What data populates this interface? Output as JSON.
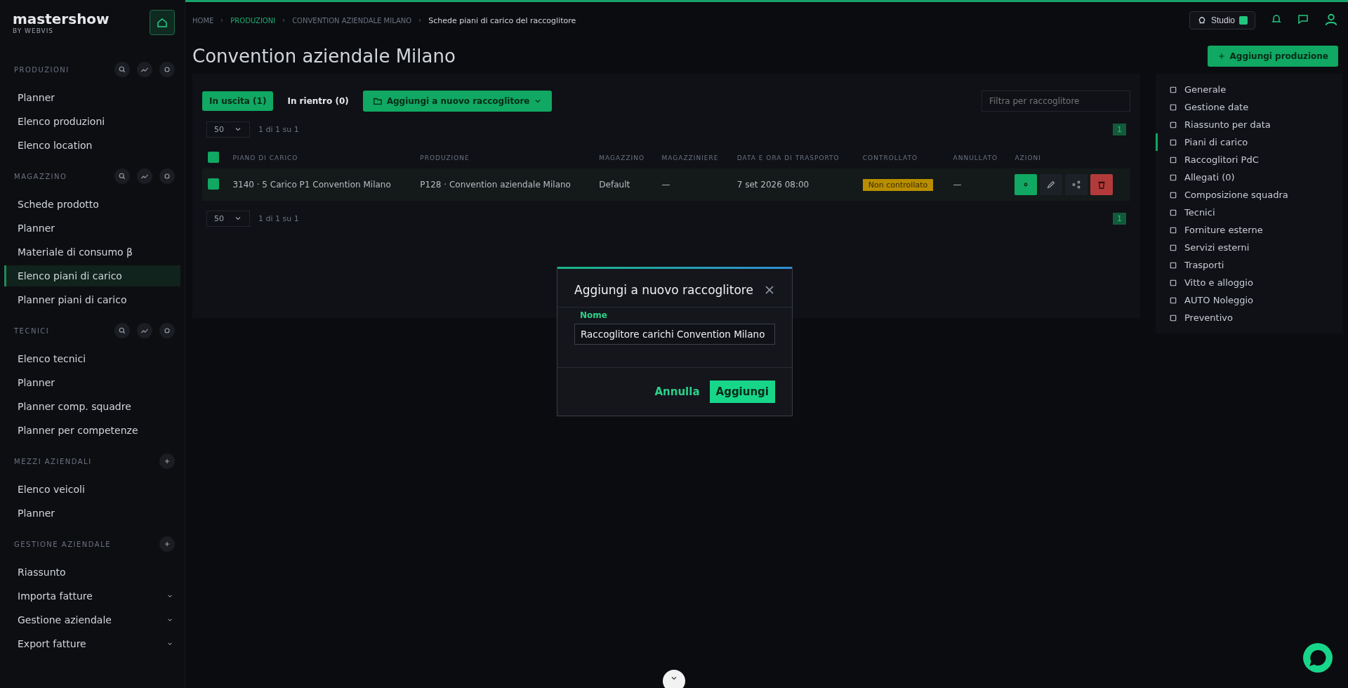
{
  "sidebar": {
    "brand": "mastershow",
    "brand_sub": "BY WEBVIS",
    "sections": [
      {
        "title": "PRODUZIONI",
        "items": [
          {
            "label": "Planner",
            "selected": false
          },
          {
            "label": "Elenco produzioni",
            "selected": false
          },
          {
            "label": "Elenco location",
            "selected": false
          }
        ]
      },
      {
        "title": "MAGAZZINO",
        "items": [
          {
            "label": "Schede prodotto",
            "selected": false
          },
          {
            "label": "Planner",
            "selected": false
          },
          {
            "label": "Materiale di consumo β",
            "selected": false
          },
          {
            "label": "Elenco piani di carico",
            "selected": true
          },
          {
            "label": "Planner piani di carico",
            "selected": false
          }
        ]
      },
      {
        "title": "TECNICI",
        "items": [
          {
            "label": "Elenco tecnici",
            "selected": false
          },
          {
            "label": "Planner",
            "selected": false
          },
          {
            "label": "Planner comp. squadre",
            "selected": false
          },
          {
            "label": "Planner per competenze",
            "selected": false
          }
        ]
      },
      {
        "title": "MEZZI AZIENDALI",
        "items": [
          {
            "label": "Elenco veicoli",
            "selected": false
          },
          {
            "label": "Planner",
            "selected": false
          }
        ]
      },
      {
        "title": "GESTIONE AZIENDALE",
        "items": [
          {
            "label": "Riassunto",
            "selected": false,
            "expandable": false
          },
          {
            "label": "Importa fatture",
            "selected": false,
            "expandable": true
          },
          {
            "label": "Gestione aziendale",
            "selected": false,
            "expandable": true
          },
          {
            "label": "Export fatture",
            "selected": false,
            "expandable": true
          }
        ]
      }
    ]
  },
  "breadcrumb": [
    "HOME",
    "PRODUZIONI",
    "CONVENTION AZIENDALE MILANO",
    "Schede piani di carico del raccoglitore"
  ],
  "top_bar": {
    "studio_button": "Studio"
  },
  "page_title": "Convention aziendale Milano",
  "add_button": "Aggiungi produzione",
  "tabs": [
    {
      "label": "In uscita (1)",
      "selected": true
    },
    {
      "label": "In rientro (0)",
      "selected": false
    }
  ],
  "bulk_button": "Aggiungi a nuovo raccoglitore",
  "filter": {
    "placeholder": "Filtra per raccoglitore"
  },
  "pager": {
    "page_size": "50",
    "summary": "1 di 1 su 1",
    "current": "1"
  },
  "table": {
    "columns": [
      "PIANO DI CARICO",
      "PRODUZIONE",
      "MAGAZZINO",
      "MAGAZZINIERE",
      "DATA E ORA DI TRASPORTO",
      "CONTROLLATO",
      "ANNULLATO",
      "AZIONI"
    ],
    "rows": [
      {
        "checked": true,
        "piano": "3140 · 5 Carico P1 Convention Milano",
        "produzione": "P128 · Convention aziendale Milano",
        "magazzino": "Default",
        "magazziniere": "—",
        "data": "7 set 2026 08:00",
        "controllato": "Non controllato",
        "annullato": "—"
      }
    ]
  },
  "header_checked": true,
  "pager_bottom": {
    "page_size": "50",
    "summary": "1 di 1 su 1",
    "current": "1"
  },
  "right_menu": [
    {
      "label": "Generale",
      "selected": false
    },
    {
      "label": "Gestione date",
      "selected": false
    },
    {
      "label": "Riassunto per data",
      "selected": false
    },
    {
      "label": "Piani di carico",
      "selected": true
    },
    {
      "label": "Raccoglitori PdC",
      "selected": false
    },
    {
      "label": "Allegati (0)",
      "selected": false
    },
    {
      "label": "Composizione squadra",
      "selected": false
    },
    {
      "label": "Tecnici",
      "selected": false
    },
    {
      "label": "Forniture esterne",
      "selected": false
    },
    {
      "label": "Servizi esterni",
      "selected": false
    },
    {
      "label": "Trasporti",
      "selected": false
    },
    {
      "label": "Vitto e alloggio",
      "selected": false
    },
    {
      "label": "AUTO Noleggio",
      "selected": false
    },
    {
      "label": "Preventivo",
      "selected": false
    }
  ],
  "dialog": {
    "title": "Aggiungi a nuovo raccoglitore",
    "field_label": "Nome",
    "field_value": "Raccoglitore carichi Convention Milano",
    "cancel": "Annulla",
    "confirm": "Aggiungi"
  }
}
